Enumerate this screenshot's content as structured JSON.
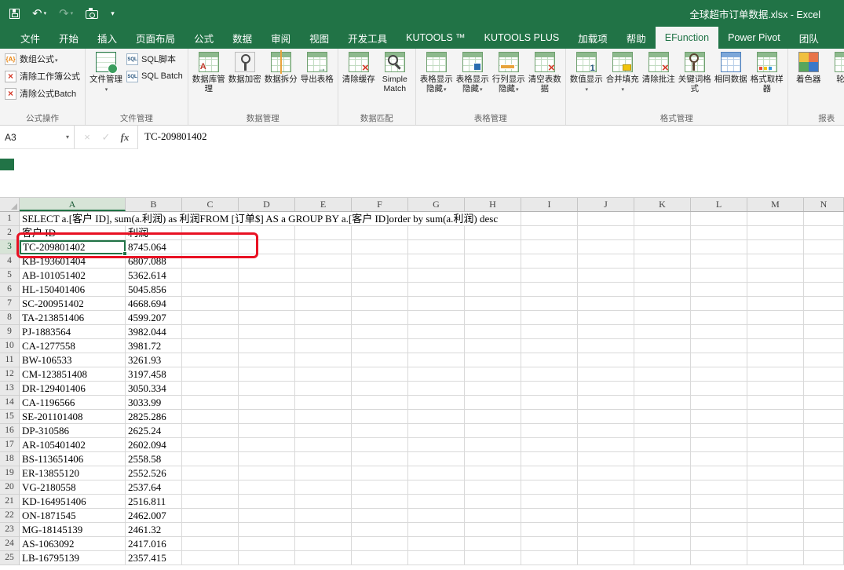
{
  "colors": {
    "accent_green": "#217346",
    "annotation_red": "#e81123"
  },
  "title_bar": {
    "title": "全球超市订单数据.xlsx - Excel"
  },
  "tabs": [
    {
      "label": "文件",
      "name": "file"
    },
    {
      "label": "开始",
      "name": "home"
    },
    {
      "label": "插入",
      "name": "insert"
    },
    {
      "label": "页面布局",
      "name": "page-layout"
    },
    {
      "label": "公式",
      "name": "formulas"
    },
    {
      "label": "数据",
      "name": "data"
    },
    {
      "label": "审阅",
      "name": "review"
    },
    {
      "label": "视图",
      "name": "view"
    },
    {
      "label": "开发工具",
      "name": "developer"
    },
    {
      "label": "KUTOOLS ™",
      "name": "kutools"
    },
    {
      "label": "KUTOOLS PLUS",
      "name": "kutools-plus"
    },
    {
      "label": "加载项",
      "name": "add-ins"
    },
    {
      "label": "帮助",
      "name": "help"
    },
    {
      "label": "EFunction",
      "name": "efunction",
      "active": true
    },
    {
      "label": "Power Pivot",
      "name": "power-pivot"
    },
    {
      "label": "团队",
      "name": "team"
    }
  ],
  "ribbon": {
    "groups": [
      {
        "label": "公式操作",
        "name": "formula-ops",
        "columns": [
          {
            "type": "stack",
            "items": [
              {
                "label": "数组公式",
                "icon": "array-formula",
                "dropdown": true
              },
              {
                "label": "清除工作簿公式",
                "icon": "clear-workbook-formula"
              },
              {
                "label": "清除公式Batch",
                "icon": "clear-formula-batch"
              }
            ]
          }
        ]
      },
      {
        "label": "文件管理",
        "name": "file-manage",
        "columns": [
          {
            "type": "large",
            "label": "文件管理",
            "icon": "file-manage",
            "dropdown": true
          },
          {
            "type": "stack",
            "items": [
              {
                "label": "SQL脚本",
                "icon": "sql"
              },
              {
                "label": "SQL Batch",
                "icon": "sql"
              }
            ]
          }
        ]
      },
      {
        "label": "数据管理",
        "name": "data-manage",
        "columns": [
          {
            "type": "large",
            "label": "数据库管理",
            "icon": "database-manage"
          },
          {
            "type": "large",
            "label": "数据加密",
            "icon": "data-encrypt"
          },
          {
            "type": "large",
            "label": "数据拆分",
            "icon": "data-split"
          },
          {
            "type": "large",
            "label": "导出表格",
            "icon": "export-table"
          }
        ]
      },
      {
        "label": "数据匹配",
        "name": "data-match",
        "columns": [
          {
            "type": "large",
            "label": "清除缓存",
            "icon": "clear-cache"
          },
          {
            "type": "large",
            "label": "Simple Match",
            "icon": "simple-match"
          }
        ]
      },
      {
        "label": "表格管理",
        "name": "table-manage",
        "columns": [
          {
            "type": "large",
            "label": "表格显示隐藏",
            "icon": "sheet-show-hide",
            "dropdown": true
          },
          {
            "type": "large",
            "label": "表格显示隐藏",
            "icon": "sheet-show-hide2",
            "dropdown": true
          },
          {
            "type": "large",
            "label": "行列显示隐藏",
            "icon": "rowcol-show-hide",
            "dropdown": true
          },
          {
            "type": "large",
            "label": "清空表数据",
            "icon": "clear-table-data"
          }
        ]
      },
      {
        "label": "格式管理",
        "name": "format-manage",
        "columns": [
          {
            "type": "large",
            "label": "数值显示",
            "icon": "number-display",
            "dropdown": true
          },
          {
            "type": "large",
            "label": "合并填充",
            "icon": "merge-fill",
            "dropdown": true
          },
          {
            "type": "large",
            "label": "清除批注",
            "icon": "clear-cache"
          },
          {
            "type": "large",
            "label": "关键词格式",
            "icon": "keyword-format"
          },
          {
            "type": "large",
            "label": "相同数据",
            "icon": "same-data"
          },
          {
            "type": "large",
            "label": "格式取样器",
            "icon": "format-sampler"
          }
        ]
      },
      {
        "label": "报表",
        "name": "report",
        "columns": [
          {
            "type": "large",
            "label": "着色器",
            "icon": "shader"
          },
          {
            "type": "large",
            "label": "轮管",
            "icon": "cutoff"
          }
        ]
      }
    ]
  },
  "formula_bar": {
    "name_box": "A3",
    "cancel": "×",
    "enter": "✓",
    "fx": "fx",
    "content": "TC-209801402"
  },
  "grid": {
    "columns": [
      "A",
      "B",
      "C",
      "D",
      "E",
      "F",
      "G",
      "H",
      "I",
      "J",
      "K",
      "L",
      "M",
      "N"
    ],
    "active_column": "A",
    "active_row": 3,
    "row1": "SELECT  a.[客户 ID],  sum(a.利润) as 利润FROM  [订单$] AS a GROUP BY  a.[客户 ID]order by  sum(a.利润) desc",
    "header_row": {
      "a": "客户 ID",
      "b": "利润"
    },
    "rows": [
      [
        "TC-209801402",
        "8745.064"
      ],
      [
        "KB-193601404",
        "6807.088"
      ],
      [
        "AB-101051402",
        "5362.614"
      ],
      [
        "HL-150401406",
        "5045.856"
      ],
      [
        "SC-200951402",
        "4668.694"
      ],
      [
        "TA-213851406",
        "4599.207"
      ],
      [
        "PJ-1883564",
        "3982.044"
      ],
      [
        "CA-1277558",
        "3981.72"
      ],
      [
        "BW-106533",
        "3261.93"
      ],
      [
        "CM-123851408",
        "3197.458"
      ],
      [
        "DR-129401406",
        "3050.334"
      ],
      [
        "CA-1196566",
        "3033.99"
      ],
      [
        "SE-201101408",
        "2825.286"
      ],
      [
        "DP-310586",
        "2625.24"
      ],
      [
        "AR-105401402",
        "2602.094"
      ],
      [
        "BS-113651406",
        "2558.58"
      ],
      [
        "ER-13855120",
        "2552.526"
      ],
      [
        "VG-2180558",
        "2537.64"
      ],
      [
        "KD-164951406",
        "2516.811"
      ],
      [
        "ON-1871545",
        "2462.007"
      ],
      [
        "MG-18145139",
        "2461.32"
      ],
      [
        "AS-1063092",
        "2417.016"
      ],
      [
        "LB-16795139",
        "2357.415"
      ]
    ]
  }
}
